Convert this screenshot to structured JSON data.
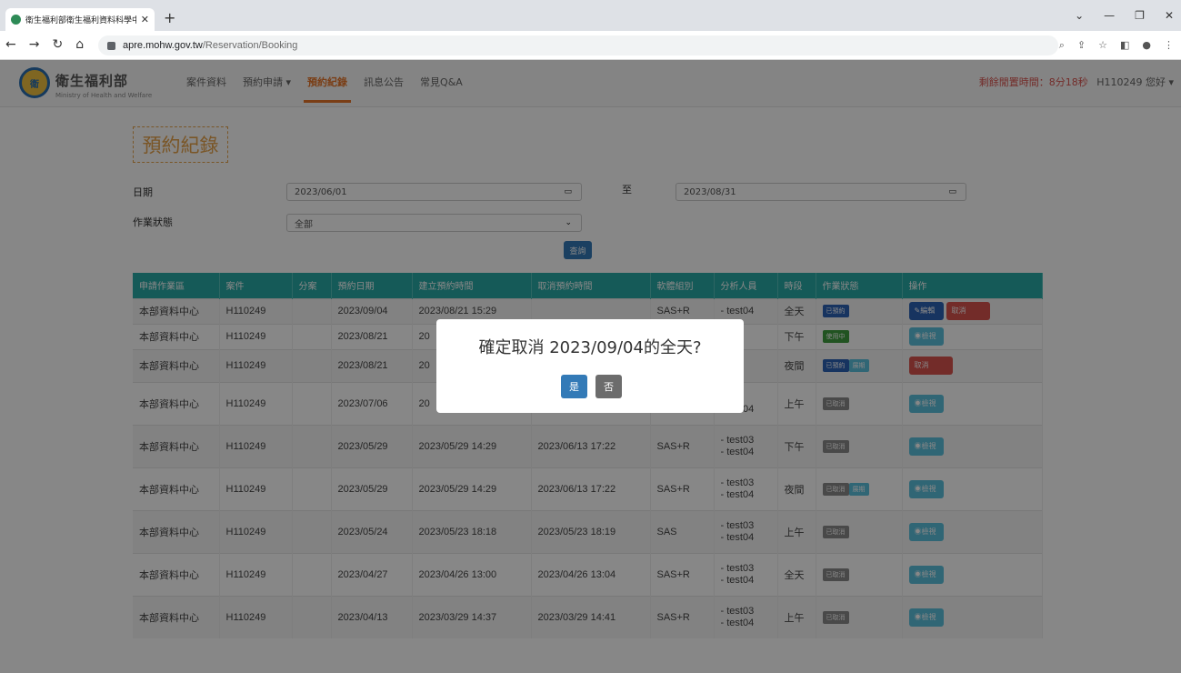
{
  "browser": {
    "tab_title": "衛生福利部衛生福利資料科學中心",
    "new_tab": "+",
    "url_host": "apre.mohw.gov.tw",
    "url_path": "/Reservation/Booking"
  },
  "site": {
    "logo_text": "衛",
    "name_cn": "衛生福利部",
    "name_en": "Ministry of Health and Welfare",
    "menu": [
      "案件資料",
      "預約申請 ▾",
      "預約紀錄",
      "訊息公告",
      "常見Q&A"
    ],
    "session_label": "剩餘閒置時間：8分18秒",
    "user_greeting": "H110249 您好 ▾"
  },
  "page_title": "預約紀錄",
  "filters": {
    "date_label": "日期",
    "date_from": "2023/06/01",
    "to_label": "至",
    "date_to": "2023/08/31",
    "status_label": "作業狀態",
    "status_value": "全部",
    "query_button": "查詢"
  },
  "table": {
    "headers": [
      "申請作業區",
      "案件",
      "分案",
      "預約日期",
      "建立預約時間",
      "取消預約時間",
      "軟體組別",
      "分析人員",
      "時段",
      "作業狀態",
      "操作"
    ],
    "rows": [
      {
        "area": "本部資料中心",
        "case": "H110249",
        "sub": "",
        "date": "2023/09/04",
        "created": "2023/08/21 15:29",
        "cancelled": "",
        "software": "SAS+R",
        "analyst1": "- test04",
        "analyst2": "",
        "slot": "全天",
        "status": "已預約",
        "status2": "",
        "actions": [
          "✎編輯",
          "取消"
        ]
      },
      {
        "area": "本部資料中心",
        "case": "H110249",
        "sub": "",
        "date": "2023/08/21",
        "created": "20",
        "cancelled": "",
        "software": "",
        "analyst1": "t03",
        "analyst2": "",
        "slot": "下午",
        "status": "使用中",
        "status2": "",
        "actions": [
          "◉檢視"
        ]
      },
      {
        "area": "本部資料中心",
        "case": "H110249",
        "sub": "",
        "date": "2023/08/21",
        "created": "20",
        "cancelled": "",
        "software": "",
        "analyst1": "t03",
        "analyst2": "",
        "slot": "夜間",
        "status": "已預約",
        "status2": "展期",
        "actions": [
          "取消"
        ]
      },
      {
        "area": "本部資料中心",
        "case": "H110249",
        "sub": "",
        "date": "2023/07/06",
        "created": "20",
        "cancelled": "",
        "software": "",
        "analyst1": "t03",
        "analyst2": "- test04",
        "slot": "上午",
        "status": "已取消",
        "status2": "",
        "actions": [
          "◉檢視"
        ]
      },
      {
        "area": "本部資料中心",
        "case": "H110249",
        "sub": "",
        "date": "2023/05/29",
        "created": "2023/05/29 14:29",
        "cancelled": "2023/06/13 17:22",
        "software": "SAS+R",
        "analyst1": "- test03",
        "analyst2": "- test04",
        "slot": "下午",
        "status": "已取消",
        "status2": "",
        "actions": [
          "◉檢視"
        ]
      },
      {
        "area": "本部資料中心",
        "case": "H110249",
        "sub": "",
        "date": "2023/05/29",
        "created": "2023/05/29 14:29",
        "cancelled": "2023/06/13 17:22",
        "software": "SAS+R",
        "analyst1": "- test03",
        "analyst2": "- test04",
        "slot": "夜間",
        "status": "已取消",
        "status2": "展期",
        "actions": [
          "◉檢視"
        ]
      },
      {
        "area": "本部資料中心",
        "case": "H110249",
        "sub": "",
        "date": "2023/05/24",
        "created": "2023/05/23 18:18",
        "cancelled": "2023/05/23 18:19",
        "software": "SAS",
        "analyst1": "- test03",
        "analyst2": "- test04",
        "slot": "上午",
        "status": "已取消",
        "status2": "",
        "actions": [
          "◉檢視"
        ]
      },
      {
        "area": "本部資料中心",
        "case": "H110249",
        "sub": "",
        "date": "2023/04/27",
        "created": "2023/04/26 13:00",
        "cancelled": "2023/04/26 13:04",
        "software": "SAS+R",
        "analyst1": "- test03",
        "analyst2": "- test04",
        "slot": "全天",
        "status": "已取消",
        "status2": "",
        "actions": [
          "◉檢視"
        ]
      },
      {
        "area": "本部資料中心",
        "case": "H110249",
        "sub": "",
        "date": "2023/04/13",
        "created": "2023/03/29 14:37",
        "cancelled": "2023/03/29 14:41",
        "software": "SAS+R",
        "analyst1": "- test03",
        "analyst2": "- test04",
        "slot": "上午",
        "status": "已取消",
        "status2": "",
        "actions": [
          "◉檢視"
        ]
      }
    ]
  },
  "dialog": {
    "message": "確定取消 2023/09/04的全天?",
    "yes": "是",
    "no": "否"
  },
  "colors": {
    "accent": "#e6762a",
    "header_teal": "#29aaa6",
    "primary": "#337ab7",
    "danger": "#d9534f"
  }
}
